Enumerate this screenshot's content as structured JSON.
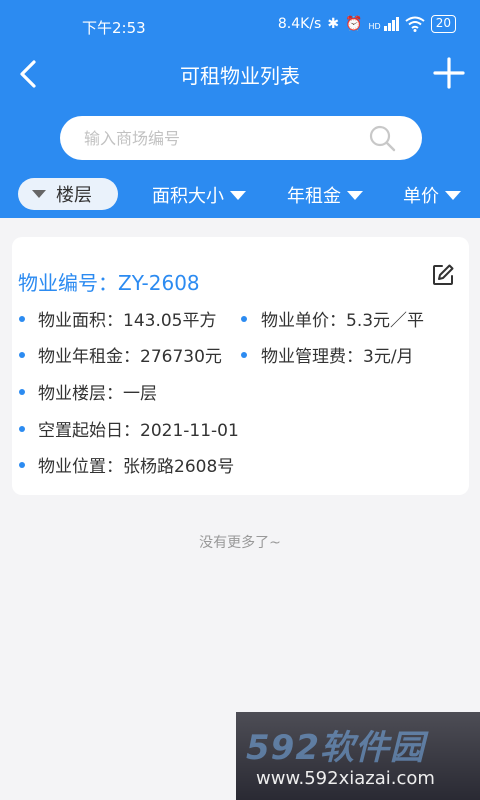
{
  "status_bar": {
    "time": "下午2:53",
    "network_speed": "8.4K/s",
    "bluetooth_icon": "✱",
    "alarm_icon": "⏰",
    "signal_label": "HD",
    "battery": "20"
  },
  "nav": {
    "title": "可租物业列表"
  },
  "search": {
    "placeholder": "输入商场编号"
  },
  "filters": {
    "floor": "楼层",
    "area": "面积大小",
    "annual_rent": "年租金",
    "unit_price": "单价"
  },
  "property": {
    "title": "物业编号：ZY-2608",
    "area": "物业面积：143.05平方",
    "unit_price": "物业单价：5.3元／平",
    "annual_rent": "物业年租金：276730元",
    "management_fee": "物业管理费：3元/月",
    "floor": "物业楼层：一层",
    "vacant_since": "空置起始日：2021-11-01",
    "location": "物业位置：张杨路2608号"
  },
  "list_end": "没有更多了~",
  "watermark": {
    "logo": "592软件园",
    "url": "www.592xiazai.com"
  },
  "colors": {
    "primary": "#2c8bf1",
    "background": "#f4f4f6"
  }
}
